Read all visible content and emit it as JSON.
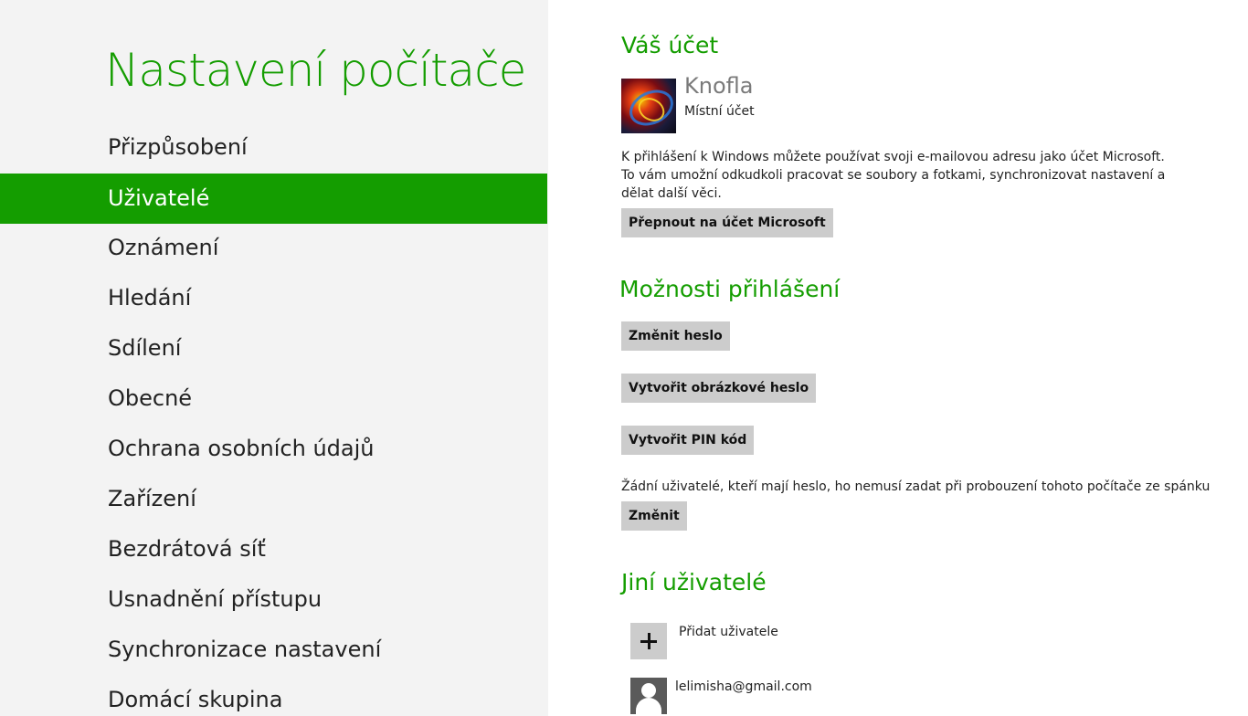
{
  "nav": {
    "title": "Nastavení počítače",
    "items": [
      {
        "label": "Přizpůsobení"
      },
      {
        "label": "Uživatelé",
        "selected": true
      },
      {
        "label": "Oznámení"
      },
      {
        "label": "Hledání"
      },
      {
        "label": "Sdílení"
      },
      {
        "label": "Obecné"
      },
      {
        "label": "Ochrana osobních údajů"
      },
      {
        "label": "Zařízení"
      },
      {
        "label": "Bezdrátová síť"
      },
      {
        "label": "Usnadnění přístupu"
      },
      {
        "label": "Synchronizace nastavení"
      },
      {
        "label": "Domácí skupina"
      }
    ]
  },
  "account": {
    "heading": "Váš účet",
    "user_name": "Knofla",
    "user_type": "Místní účet",
    "description": "K přihlášení k Windows můžete používat svoji e-mailovou adresu jako účet Microsoft. To vám umožní odkudkoli pracovat se soubory a fotkami, synchronizovat nastavení a dělat další věci.",
    "switch_button": "Přepnout na účet Microsoft"
  },
  "signin": {
    "heading": "Možnosti přihlášení",
    "change_password_button": "Změnit heslo",
    "picture_password_button": "Vytvořit obrázkové heslo",
    "pin_button": "Vytvořit PIN kód",
    "wake_text": "Žádní uživatelé, kteří mají heslo, ho nemusí zadat při probouzení tohoto počítače ze spánku",
    "change_button": "Změnit"
  },
  "other_users": {
    "heading": "Jiní uživatelé",
    "add_user_label": "Přidat uživatele",
    "users": [
      "lelimisha@gmail.com"
    ]
  },
  "colors": {
    "accent": "#149d00",
    "nav_background": "#f3f3f3",
    "button_background": "#cccccc"
  }
}
